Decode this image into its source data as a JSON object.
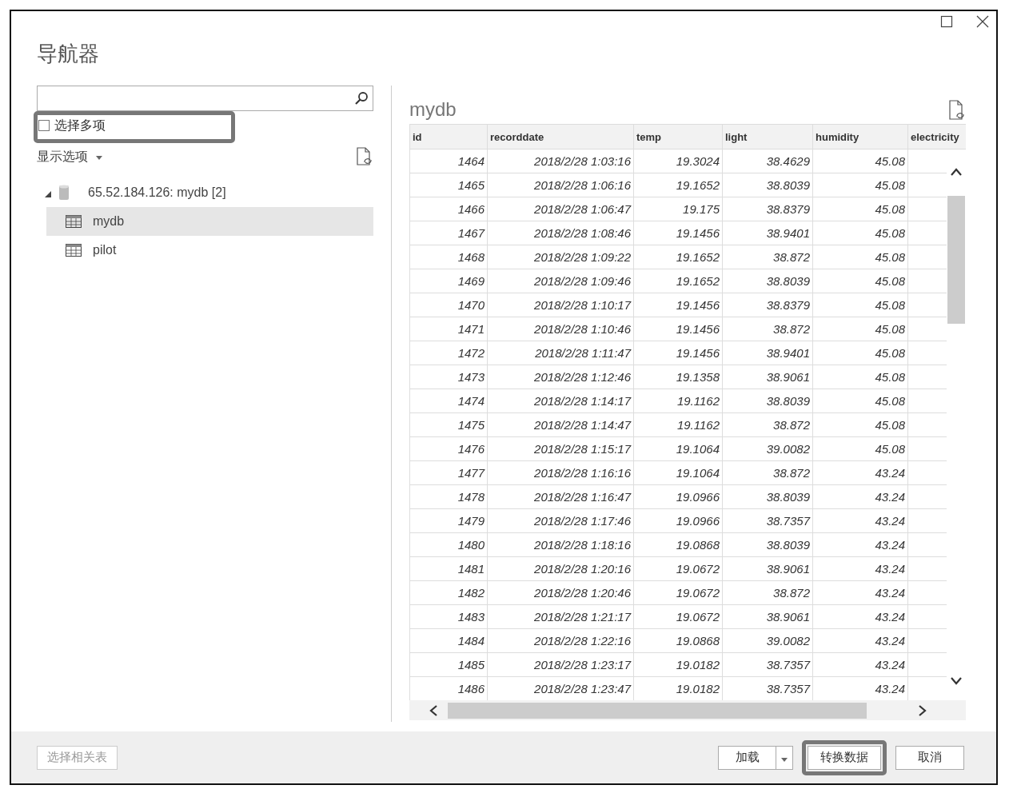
{
  "window": {
    "title": "导航器"
  },
  "select_multiple": {
    "label": "选择多项",
    "checked": false,
    "highlighted": true
  },
  "display_options": {
    "label": "显示选项"
  },
  "tree": [
    {
      "label": "65.52.184.126: mydb [2]",
      "kind": "database",
      "expanded": true,
      "selected": false,
      "children": [
        {
          "label": "mydb",
          "kind": "table",
          "selected": true
        },
        {
          "label": "pilot",
          "kind": "table",
          "selected": false
        }
      ]
    }
  ],
  "preview": {
    "title": "mydb",
    "table": {
      "columns": [
        "id",
        "recorddate",
        "temp",
        "light",
        "humidity",
        "electricity"
      ],
      "rows": [
        [
          "1464",
          "2018/2/28 1:03:16",
          "19.3024",
          "38.4629",
          "45.08"
        ],
        [
          "1465",
          "2018/2/28 1:06:16",
          "19.1652",
          "38.8039",
          "45.08"
        ],
        [
          "1466",
          "2018/2/28 1:06:47",
          "19.175",
          "38.8379",
          "45.08"
        ],
        [
          "1467",
          "2018/2/28 1:08:46",
          "19.1456",
          "38.9401",
          "45.08"
        ],
        [
          "1468",
          "2018/2/28 1:09:22",
          "19.1652",
          "38.872",
          "45.08"
        ],
        [
          "1469",
          "2018/2/28 1:09:46",
          "19.1652",
          "38.8039",
          "45.08"
        ],
        [
          "1470",
          "2018/2/28 1:10:17",
          "19.1456",
          "38.8379",
          "45.08"
        ],
        [
          "1471",
          "2018/2/28 1:10:46",
          "19.1456",
          "38.872",
          "45.08"
        ],
        [
          "1472",
          "2018/2/28 1:11:47",
          "19.1456",
          "38.9401",
          "45.08"
        ],
        [
          "1473",
          "2018/2/28 1:12:46",
          "19.1358",
          "38.9061",
          "45.08"
        ],
        [
          "1474",
          "2018/2/28 1:14:17",
          "19.1162",
          "38.8039",
          "45.08"
        ],
        [
          "1475",
          "2018/2/28 1:14:47",
          "19.1162",
          "38.872",
          "45.08"
        ],
        [
          "1476",
          "2018/2/28 1:15:17",
          "19.1064",
          "39.0082",
          "45.08"
        ],
        [
          "1477",
          "2018/2/28 1:16:16",
          "19.1064",
          "38.872",
          "43.24"
        ],
        [
          "1478",
          "2018/2/28 1:16:47",
          "19.0966",
          "38.8039",
          "43.24"
        ],
        [
          "1479",
          "2018/2/28 1:17:46",
          "19.0966",
          "38.7357",
          "43.24"
        ],
        [
          "1480",
          "2018/2/28 1:18:16",
          "19.0868",
          "38.8039",
          "43.24"
        ],
        [
          "1481",
          "2018/2/28 1:20:16",
          "19.0672",
          "38.9061",
          "43.24"
        ],
        [
          "1482",
          "2018/2/28 1:20:46",
          "19.0672",
          "38.872",
          "43.24"
        ],
        [
          "1483",
          "2018/2/28 1:21:17",
          "19.0672",
          "38.9061",
          "43.24"
        ],
        [
          "1484",
          "2018/2/28 1:22:16",
          "19.0868",
          "39.0082",
          "43.24"
        ],
        [
          "1485",
          "2018/2/28 1:23:17",
          "19.0182",
          "38.7357",
          "43.24"
        ],
        [
          "1486",
          "2018/2/28 1:23:47",
          "19.0182",
          "38.7357",
          "43.24"
        ]
      ]
    }
  },
  "footer": {
    "left_button": {
      "label": "选择相关表",
      "disabled": true
    },
    "buttons": [
      {
        "label": "加载",
        "kind": "split"
      },
      {
        "label": "转换数据",
        "kind": "plain",
        "highlighted": true
      },
      {
        "label": "取消",
        "kind": "plain"
      }
    ]
  }
}
